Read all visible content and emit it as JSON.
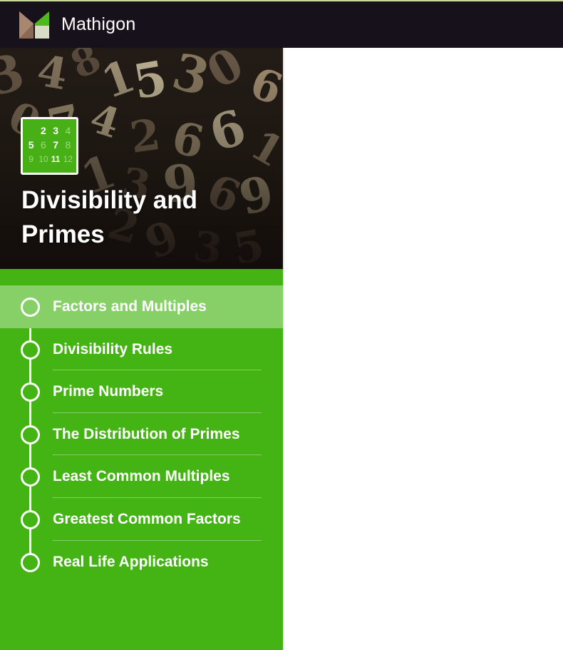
{
  "app": {
    "brand": "Mathigon",
    "colors": {
      "topbar": "#16111a",
      "sidebar": "#44b314",
      "active_item": "#86d067",
      "text": "#ffffff"
    }
  },
  "course": {
    "title": "Divisibility and Primes",
    "icon": {
      "rows": [
        [
          "",
          "2",
          "3",
          "4"
        ],
        [
          "5",
          "6",
          "7",
          "8"
        ],
        [
          "9",
          "10",
          "11",
          "12"
        ]
      ]
    }
  },
  "chapters": [
    {
      "label": "Factors and Multiples",
      "active": true
    },
    {
      "label": "Divisibility Rules",
      "active": false
    },
    {
      "label": "Prime Numbers",
      "active": false
    },
    {
      "label": "The Distribution of Primes",
      "active": false
    },
    {
      "label": "Least Common Multiples",
      "active": false
    },
    {
      "label": "Greatest Common Factors",
      "active": false
    },
    {
      "label": "Real Life Applications",
      "active": false
    }
  ]
}
